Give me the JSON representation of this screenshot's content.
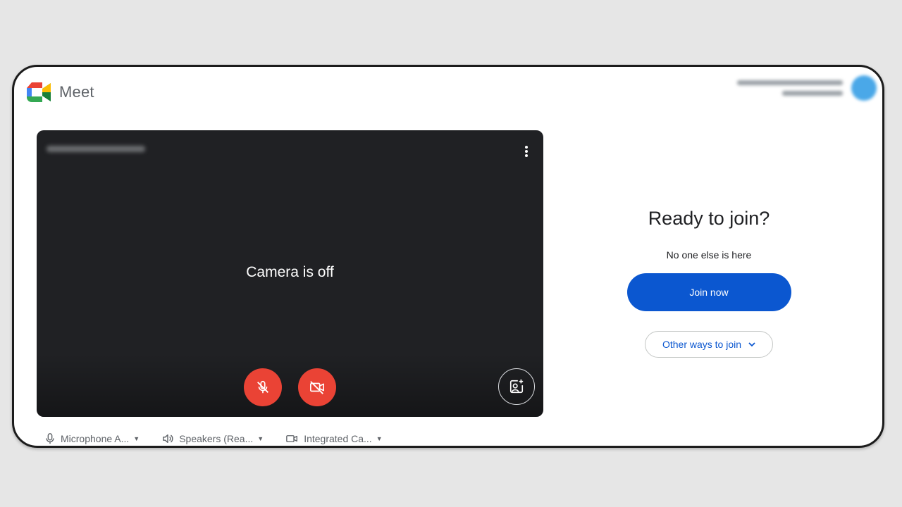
{
  "app": {
    "name": "Meet"
  },
  "preview": {
    "status_text": "Camera is off"
  },
  "devices": [
    {
      "label": "Microphone A...",
      "icon": "microphone-icon"
    },
    {
      "label": "Speakers (Rea...",
      "icon": "speaker-icon"
    },
    {
      "label": "Integrated Ca...",
      "icon": "camera-icon"
    }
  ],
  "join": {
    "title": "Ready to join?",
    "subtitle": "No one else is here",
    "join_label": "Join now",
    "other_label": "Other ways to join"
  },
  "colors": {
    "accent": "#0b57d0",
    "danger": "#ea4335",
    "video_bg": "#202124"
  }
}
